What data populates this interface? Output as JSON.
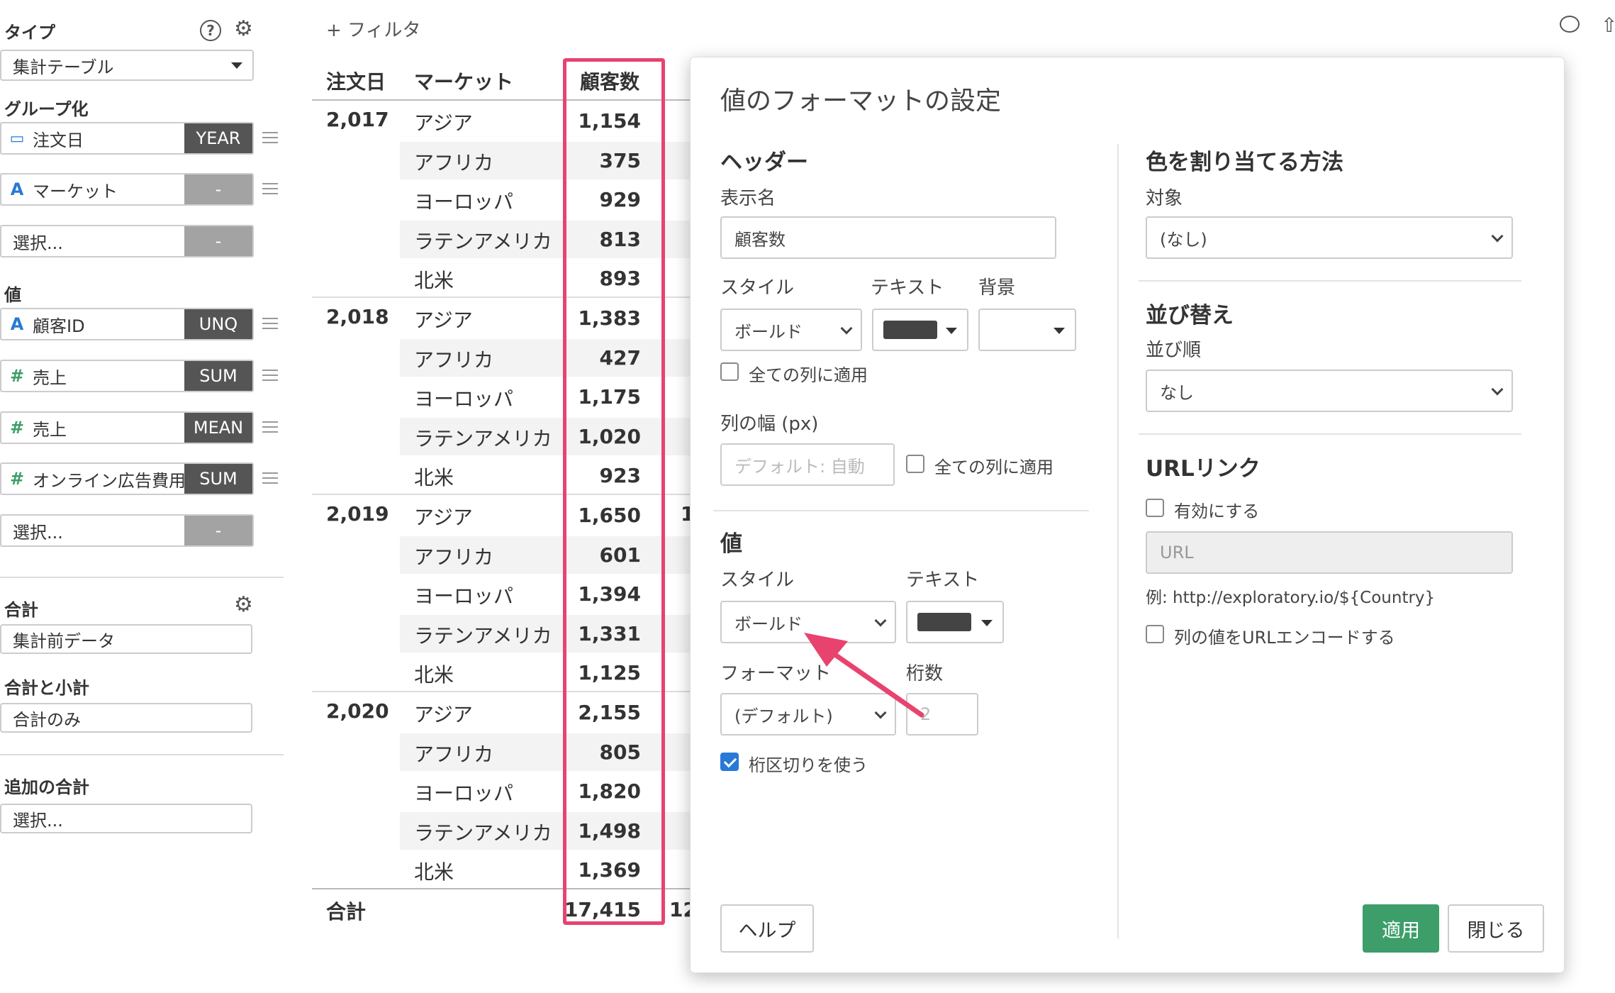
{
  "sidebar": {
    "type_title": "タイプ",
    "type_value": "集計テーブル",
    "group_title": "グループ化",
    "group_fields": [
      {
        "icon": "calendar-icon",
        "label": "注文日",
        "agg": "YEAR"
      },
      {
        "icon": "A",
        "label": "マーケット",
        "agg": "-"
      },
      {
        "icon": "",
        "label": "選択...",
        "agg": "-"
      }
    ],
    "value_title": "値",
    "value_fields": [
      {
        "icon": "A",
        "label": "顧客ID",
        "agg": "UNQ"
      },
      {
        "icon": "#",
        "label": "売上",
        "agg": "SUM"
      },
      {
        "icon": "#",
        "label": "売上",
        "agg": "MEAN"
      },
      {
        "icon": "#",
        "label": "オンライン広告費用",
        "agg": "SUM"
      },
      {
        "icon": "",
        "label": "選択...",
        "agg": "-"
      }
    ],
    "total_title": "合計",
    "total_value": "集計前データ",
    "subtotal_title": "合計と小計",
    "subtotal_value": "合計のみ",
    "extra_title": "追加の合計",
    "extra_value": "選択..."
  },
  "toolbar": {
    "filter_label": "+ フィルタ"
  },
  "table": {
    "headers": [
      "注文日",
      "マーケット",
      "顧客数"
    ],
    "groups": [
      {
        "year": "2,017",
        "rows": [
          [
            "アジア",
            "1,154"
          ],
          [
            "アフリカ",
            "375"
          ],
          [
            "ヨーロッパ",
            "929"
          ],
          [
            "ラテンアメリカ",
            "813"
          ],
          [
            "北米",
            "893"
          ]
        ]
      },
      {
        "year": "2,018",
        "rows": [
          [
            "アジア",
            "1,383"
          ],
          [
            "アフリカ",
            "427"
          ],
          [
            "ヨーロッパ",
            "1,175"
          ],
          [
            "ラテンアメリカ",
            "1,020"
          ],
          [
            "北米",
            "923"
          ]
        ]
      },
      {
        "year": "2,019",
        "rows": [
          [
            "アジア",
            "1,650"
          ],
          [
            "アフリカ",
            "601"
          ],
          [
            "ヨーロッパ",
            "1,394"
          ],
          [
            "ラテンアメリカ",
            "1,331"
          ],
          [
            "北米",
            "1,125"
          ]
        ]
      },
      {
        "year": "2,020",
        "rows": [
          [
            "アジア",
            "2,155"
          ],
          [
            "アフリカ",
            "805"
          ],
          [
            "ヨーロッパ",
            "1,820"
          ],
          [
            "ラテンアメリカ",
            "1,498"
          ],
          [
            "北米",
            "1,369"
          ]
        ]
      }
    ],
    "total_label": "合計",
    "total_value": "17,415",
    "peek_1": "1",
    "peek_2": "12"
  },
  "modal": {
    "title": "値のフォーマットの設定",
    "header_section": "ヘッダー",
    "display_name_label": "表示名",
    "display_name_value": "顧客数",
    "style_label": "スタイル",
    "text_label": "テキスト",
    "bg_label": "背景",
    "header_style_value": "ボールド",
    "apply_all_label": "全ての列に適用",
    "col_width_label": "列の幅 (px)",
    "col_width_placeholder": "デフォルト: 自動",
    "col_width_apply_all": "全ての列に適用",
    "value_section": "値",
    "value_style_label": "スタイル",
    "value_text_label": "テキスト",
    "value_style_value": "ボールド",
    "format_label": "フォーマット",
    "digits_label": "桁数",
    "format_value": "(デフォルト)",
    "digits_placeholder": "2",
    "separator_label": "桁区切りを使う",
    "color_section": "色を割り当てる方法",
    "target_label": "対象",
    "target_value": "(なし)",
    "sort_section": "並び替え",
    "sort_order_label": "並び順",
    "sort_order_value": "なし",
    "url_section": "URLリンク",
    "url_enable_label": "有効にする",
    "url_placeholder": "URL",
    "url_example": "例: http://exploratory.io/${Country}",
    "url_encode_label": "列の値をURLエンコードする",
    "help_button": "ヘルプ",
    "apply_button": "適用",
    "close_button": "閉じる"
  },
  "colors": {
    "highlight": "#e8436f",
    "primary_button": "#3d9e6a",
    "checkbox_on": "#2979d6"
  }
}
